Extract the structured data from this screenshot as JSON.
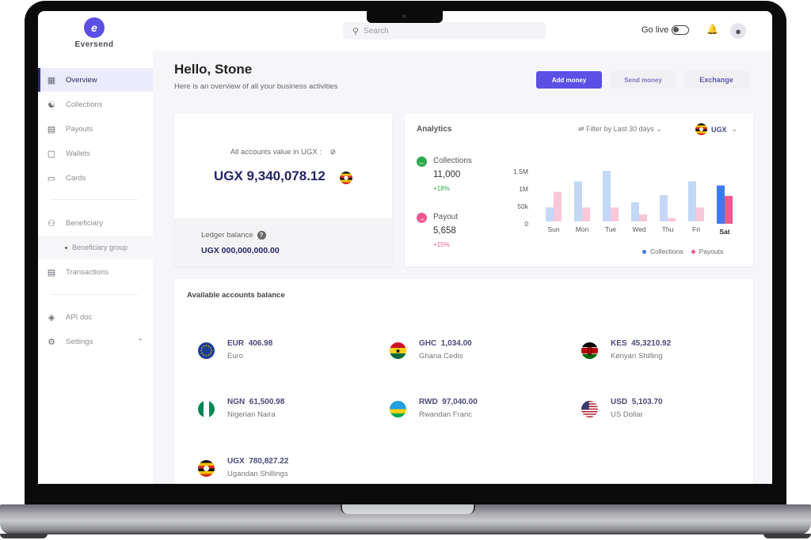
{
  "app": {
    "brand": "Eversend"
  },
  "header": {
    "search_placeholder": "Search",
    "go_live_label": "Go live",
    "go_live_on": false
  },
  "sidebar": {
    "items": [
      {
        "label": "Overview",
        "icon": "grid-icon",
        "active": true
      },
      {
        "label": "Collections",
        "icon": "money-bag-icon"
      },
      {
        "label": "Payouts",
        "icon": "payout-icon"
      },
      {
        "label": "Wallets",
        "icon": "wallet-icon"
      },
      {
        "label": "Cards",
        "icon": "card-icon"
      },
      {
        "label": "Beneficiary",
        "icon": "users-icon"
      },
      {
        "label": "Beneficiary group",
        "icon": "dot-icon",
        "sub": true
      },
      {
        "label": "Transactions",
        "icon": "receipt-icon"
      },
      {
        "label": "API doc",
        "icon": "api-icon"
      },
      {
        "label": "Settings",
        "icon": "gear-icon",
        "expanded": true
      }
    ]
  },
  "main": {
    "greeting": "Hello, Stone",
    "subtitle": "Here is an overview of all your business activities",
    "actions": {
      "add_money": "Add money",
      "send_money": "Send money",
      "exchange": "Exchange"
    },
    "total": {
      "label": "All accounts value in UGX :",
      "value": "UGX 9,340,078.12",
      "ledger_label": "Ledger balance",
      "ledger_value": "UGX  000,000,000.00"
    },
    "analytics": {
      "title": "Analytics",
      "filter_label": "Filter by Last 30 days",
      "currency": "UGX",
      "collections": {
        "label": "Collections",
        "value": "11,000",
        "change": "+18%"
      },
      "payout": {
        "label": "Payout",
        "value": "5,658",
        "change": "+15%"
      }
    },
    "balances": {
      "title": "Available accounts balance",
      "accounts": [
        {
          "code": "EUR",
          "amount": "406.98",
          "name": "Euro",
          "flag": "eu"
        },
        {
          "code": "GHC",
          "amount": "1,034.00",
          "name": "Ghana Cedis",
          "flag": "gh"
        },
        {
          "code": "KES",
          "amount": "45,3210.92",
          "name": "Kenyan Shilling",
          "flag": "ke"
        },
        {
          "code": "NGN",
          "amount": "61,500.98",
          "name": "Nigerian Naira",
          "flag": "ng"
        },
        {
          "code": "RWD",
          "amount": "97,040.00",
          "name": "Rwandan Franc",
          "flag": "rw"
        },
        {
          "code": "USD",
          "amount": "5,103.70",
          "name": "US Dollar",
          "flag": "us"
        },
        {
          "code": "UGX",
          "amount": "780,827.22",
          "name": "Ugandan Shillings",
          "flag": "ug"
        }
      ]
    }
  },
  "colors": {
    "accent": "#5b4fe6",
    "collections": "#3b7be8",
    "collections_light": "#c3d7f7",
    "payouts": "#f0588f",
    "payouts_light": "#f8c7d9",
    "collections_icon": "#2fa84f",
    "payout_icon": "#ef5a92"
  },
  "chart_data": {
    "type": "bar",
    "categories": [
      "Sun",
      "Mon",
      "Tue",
      "Wed",
      "Thu",
      "Fri",
      "Sat"
    ],
    "highlight": "Sat",
    "series": [
      {
        "name": "Collections",
        "values": [
          0.4,
          1.15,
          1.45,
          0.55,
          0.75,
          1.15,
          1.1
        ]
      },
      {
        "name": "Payouts",
        "values": [
          0.85,
          0.4,
          0.4,
          0.2,
          0.1,
          0.4,
          0.8
        ]
      }
    ],
    "unit": "M",
    "yticks": [
      "1.5M",
      "1M",
      "50k",
      "0"
    ],
    "ylim": [
      0,
      1.5
    ],
    "legend": [
      "Collections",
      "Payouts"
    ],
    "legend_position": "bottom-right",
    "grid": false
  }
}
